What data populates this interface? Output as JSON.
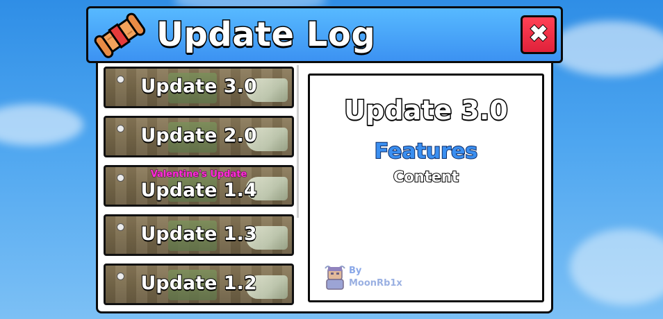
{
  "window": {
    "title": "Update Log",
    "close_label": "✖",
    "title_icon": "scroll-icon"
  },
  "updates": [
    {
      "label": "Update 3.0",
      "tag": ""
    },
    {
      "label": "Update 2.0",
      "tag": ""
    },
    {
      "label": "Update 1.4",
      "tag": "Valentine's Update"
    },
    {
      "label": "Update 1.3",
      "tag": ""
    },
    {
      "label": "Update 1.2",
      "tag": ""
    }
  ],
  "detail": {
    "title": "Update 3.0",
    "section": "Features",
    "content": "Content"
  },
  "credit": {
    "by": "By",
    "name": "MoonRb1x",
    "icon": "avatar-icon"
  },
  "colors": {
    "header": "#3c92f2",
    "close": "#e0213a",
    "section": "#3b8ff0",
    "tag": "#ff2fd8"
  }
}
